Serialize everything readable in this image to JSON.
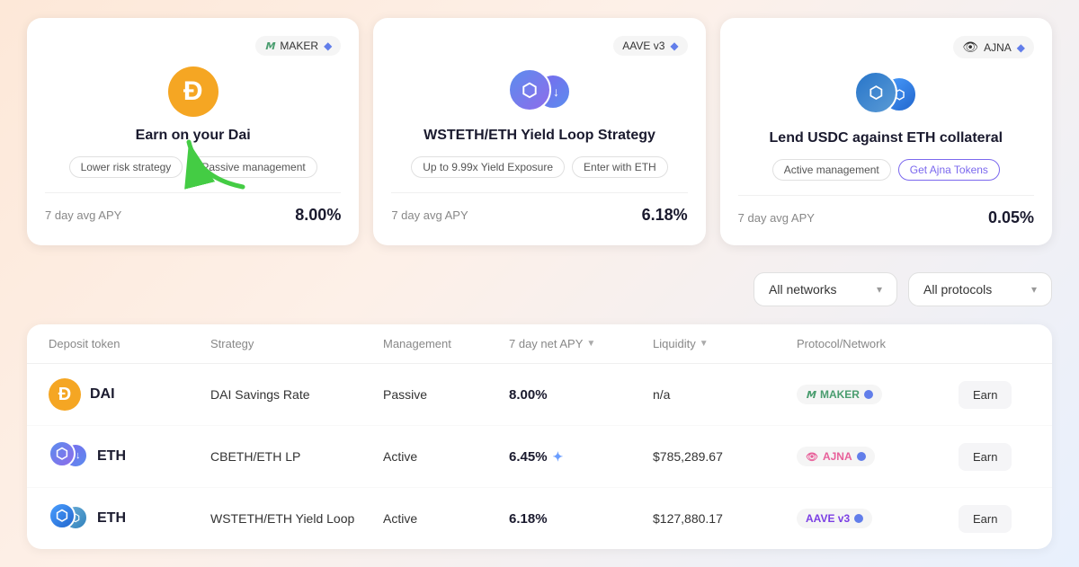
{
  "cards": [
    {
      "id": "dai-card",
      "protocol": "MAKER",
      "title": "Earn on your Dai",
      "tags": [
        "Lower risk strategy",
        "Passive management"
      ],
      "apy_label": "7 day avg APY",
      "apy_value": "8.00%",
      "token_type": "dai"
    },
    {
      "id": "wsteth-card",
      "protocol": "AAVE v3",
      "title": "WSTETH/ETH Yield Loop Strategy",
      "tags": [
        "Up to 9.99x Yield Exposure",
        "Enter with ETH"
      ],
      "apy_label": "7 day avg APY",
      "apy_value": "6.18%",
      "token_type": "eth-double"
    },
    {
      "id": "usdc-card",
      "protocol": "AJNA",
      "title": "Lend USDC against ETH collateral",
      "tags": [
        "Active management",
        "Get Ajna Tokens"
      ],
      "apy_label": "7 day avg APY",
      "apy_value": "0.05%",
      "token_type": "usdc-eth"
    }
  ],
  "filters": {
    "network": "All networks",
    "protocol": "All protocols"
  },
  "table": {
    "headers": [
      "Deposit token",
      "Strategy",
      "Management",
      "7 day net APY",
      "Liquidity",
      "Protocol/Network",
      ""
    ],
    "rows": [
      {
        "token_type": "dai",
        "token": "DAI",
        "strategy": "DAI Savings Rate",
        "management": "Passive",
        "apy": "8.00%",
        "apy_sparkle": false,
        "liquidity": "n/a",
        "protocol": "MAKER",
        "earn_label": "Earn"
      },
      {
        "token_type": "eth-double",
        "token": "ETH",
        "strategy": "CBETH/ETH LP",
        "management": "Active",
        "apy": "6.45%",
        "apy_sparkle": true,
        "liquidity": "$785,289.67",
        "protocol": "AJNA",
        "earn_label": "Earn"
      },
      {
        "token_type": "eth-double2",
        "token": "ETH",
        "strategy": "WSTETH/ETH Yield Loop",
        "management": "Active",
        "apy": "6.18%",
        "apy_sparkle": false,
        "liquidity": "$127,880.17",
        "protocol": "AAVE v3",
        "earn_label": "Earn"
      }
    ]
  }
}
